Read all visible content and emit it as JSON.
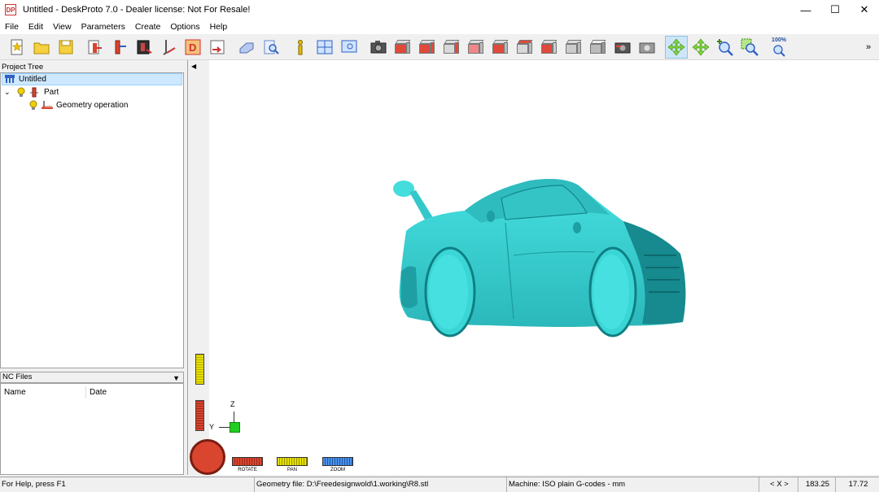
{
  "window": {
    "title": "Untitled - DeskProto 7.0 - Dealer license: Not For Resale!",
    "logo_text": "DP",
    "minimize": "—",
    "maximize": "☐",
    "close": "✕"
  },
  "menu": [
    "File",
    "Edit",
    "View",
    "Parameters",
    "Create",
    "Options",
    "Help"
  ],
  "toolbar": {
    "zoom_label": "100%",
    "overflow": "»"
  },
  "project_tree": {
    "header": "Project Tree",
    "root": "Untitled",
    "part": "Part",
    "operation": "Geometry operation"
  },
  "nc_files": {
    "header": "NC Files",
    "col_name": "Name",
    "col_date": "Date"
  },
  "mouse_panel": {
    "rotate": "ROTATE",
    "pan": "PAN",
    "zoom": "ZOOM"
  },
  "axes": {
    "z": "Z",
    "y": "Y"
  },
  "status": {
    "help": "For Help, press F1",
    "geometry": "Geometry file: D:\\Freedesignwold\\1.working\\R8.stl",
    "machine": "Machine: ISO plain G-codes - mm",
    "axis": "< X >",
    "coord1": "183.25",
    "coord2": "17.72"
  },
  "colors": {
    "model": "#3ad6d6",
    "model_dark": "#0f7f83",
    "selection": "#cde8ff"
  }
}
